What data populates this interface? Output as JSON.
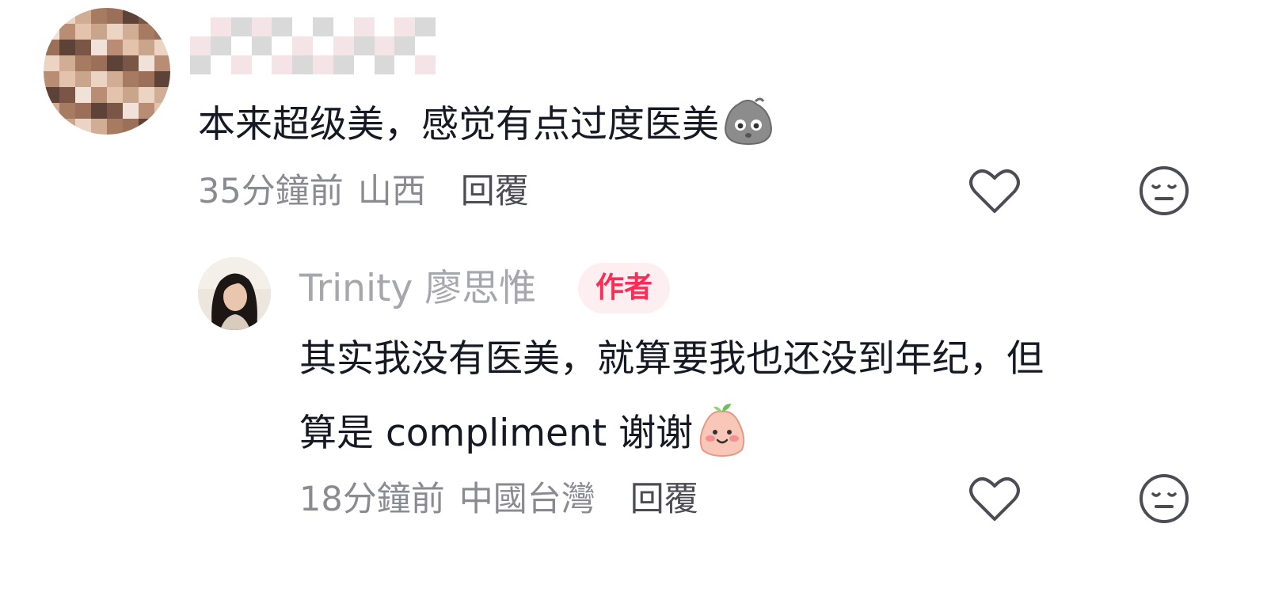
{
  "comment": {
    "text": "本来超级美，感觉有点过度医美",
    "emoji": "sweating-face-emoji",
    "time": "35分鐘前",
    "location": "山西",
    "reply_label": "回覆"
  },
  "reply": {
    "username": "Trinity 廖思惟",
    "badge": "作者",
    "text_line1": "其实我没有医美，就算要我也还没到年纪，但",
    "text_line2": "算是 compliment 谢谢",
    "emoji": "blushing-face-emoji",
    "time": "18分鐘前",
    "location": "中國台灣",
    "reply_label": "回覆"
  },
  "icons": {
    "like": "heart-outline-icon",
    "dislike": "expressionless-face-icon"
  },
  "colors": {
    "text_primary": "#161823",
    "text_secondary": "#8a8b91",
    "reply_link": "#4c4d54",
    "badge_text": "#fe2c55",
    "badge_bg": "#fdeef1",
    "icon_stroke": "#4c4d54"
  }
}
